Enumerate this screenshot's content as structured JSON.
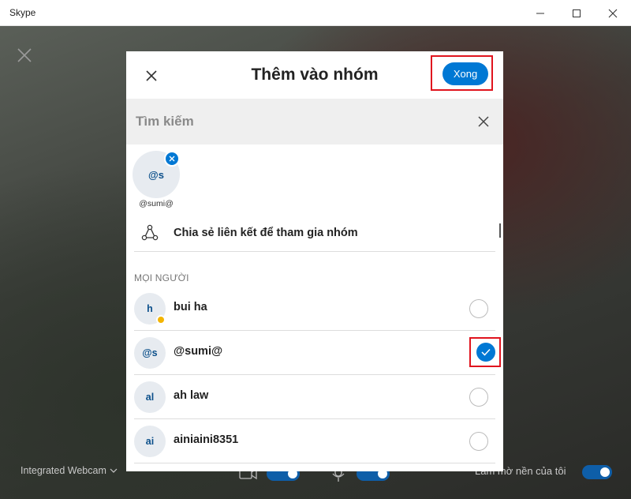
{
  "window": {
    "title": "Skype",
    "controls": {
      "minimize": "minimize-icon",
      "maximize": "maximize-icon",
      "close": "close-icon"
    }
  },
  "call": {
    "camera_label": "Integrated Webcam",
    "blur_label": "Làm mờ nền của tôi",
    "blur_on": true,
    "camera_on": true,
    "mic_on": true
  },
  "dialog": {
    "title": "Thêm vào nhóm",
    "done_label": "Xong",
    "search_placeholder": "Tìm kiếm",
    "selected": [
      {
        "initials": "@s",
        "label": "@sumi@"
      }
    ],
    "share_label": "Chia sẻ liên kết để tham gia nhóm",
    "section_people": "MỌI NGƯỜI",
    "contacts": [
      {
        "initials": "h",
        "name": "bui ha",
        "away": true,
        "checked": false
      },
      {
        "initials": "@s",
        "name": "@sumi@",
        "away": false,
        "checked": true
      },
      {
        "initials": "al",
        "name": "ah law",
        "away": false,
        "checked": false
      },
      {
        "initials": "ai",
        "name": "ainiaini8351",
        "away": false,
        "checked": false
      }
    ]
  },
  "colors": {
    "accent": "#0078d4",
    "highlight_box": "#e0141e",
    "away_status": "#f3b400"
  }
}
